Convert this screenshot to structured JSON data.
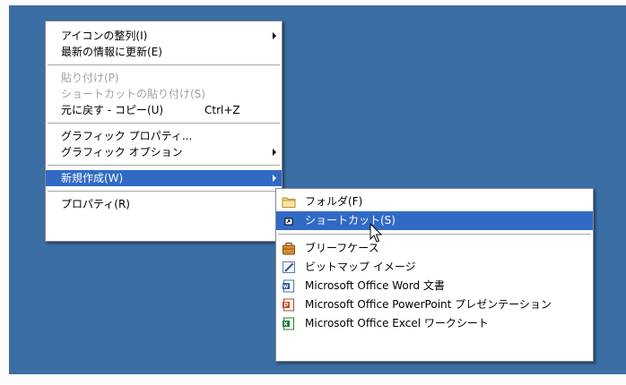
{
  "context_menu": {
    "items": [
      {
        "label": "アイコンの整列(I)",
        "submenu": true
      },
      {
        "label": "最新の情報に更新(E)"
      },
      {
        "label": "貼り付け(P)",
        "disabled": true
      },
      {
        "label": "ショートカットの貼り付け(S)",
        "disabled": true
      },
      {
        "label": "元に戻す - コピー(U)",
        "shortcut": "Ctrl+Z"
      },
      {
        "label": "グラフィック プロパティ..."
      },
      {
        "label": "グラフィック オプション",
        "submenu": true
      },
      {
        "label": "新規作成(W)",
        "submenu": true,
        "highlighted": true
      },
      {
        "label": "プロパティ(R)"
      }
    ]
  },
  "new_submenu": {
    "items": [
      {
        "label": "フォルダ(F)",
        "icon": "folder-icon"
      },
      {
        "label": "ショートカット(S)",
        "icon": "shortcut-icon",
        "highlighted": true
      },
      {
        "label": "ブリーフケース",
        "icon": "briefcase-icon"
      },
      {
        "label": "ビットマップ イメージ",
        "icon": "bitmap-image-icon"
      },
      {
        "label": "Microsoft Office Word 文書",
        "icon": "word-document-icon"
      },
      {
        "label": "Microsoft Office PowerPoint プレゼンテーション",
        "icon": "powerpoint-presentation-icon"
      },
      {
        "label": "Microsoft Office Excel ワークシート",
        "icon": "excel-worksheet-icon"
      }
    ]
  },
  "colors": {
    "desktop": "#3a6ea5",
    "highlight": "#316ac5",
    "disabled_text": "#a0a0a0"
  }
}
